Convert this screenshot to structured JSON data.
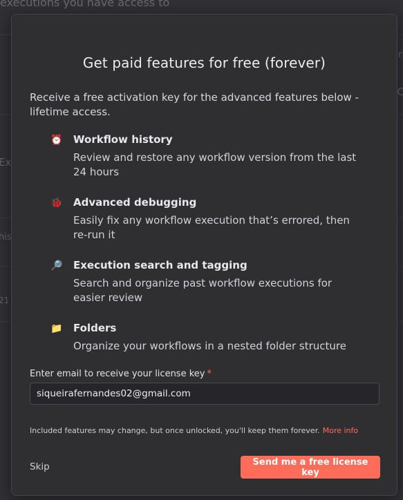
{
  "background": {
    "top_text": "executions you have access to",
    "left_fragments": [
      "Ex",
      "his",
      "21"
    ],
    "right_fragments": [
      "ri",
      "C"
    ]
  },
  "modal": {
    "title": "Get paid features for free (forever)",
    "intro": "Receive a free activation key for the advanced features below - lifetime access.",
    "features": [
      {
        "icon": "clock-icon",
        "icon_glyph": "⏰",
        "title": "Workflow history",
        "description": "Review and restore any workflow version from the last 24 hours"
      },
      {
        "icon": "bug-icon",
        "icon_glyph": "🐞",
        "title": "Advanced debugging",
        "description": "Easily fix any workflow execution that’s errored, then re-run it"
      },
      {
        "icon": "magnifier-icon",
        "icon_glyph": "🔎",
        "title": "Execution search and tagging",
        "description": "Search and organize past workflow executions for easier review"
      },
      {
        "icon": "folder-icon",
        "icon_glyph": "📁",
        "title": "Folders",
        "description": "Organize your workflows in a nested folder structure"
      }
    ],
    "email_label": "Enter email to receive your license key",
    "required_marker": "*",
    "email_value": "siqueirafernandes02@gmail.com",
    "disclaimer": "Included features may change, but once unlocked, you'll keep them forever.",
    "more_info_label": "More info",
    "skip_label": "Skip",
    "cta_label": "Send me a free license key"
  },
  "colors": {
    "accent": "#ff6d5a",
    "modal_bg": "#2f2f32",
    "input_bg": "#26262a"
  }
}
